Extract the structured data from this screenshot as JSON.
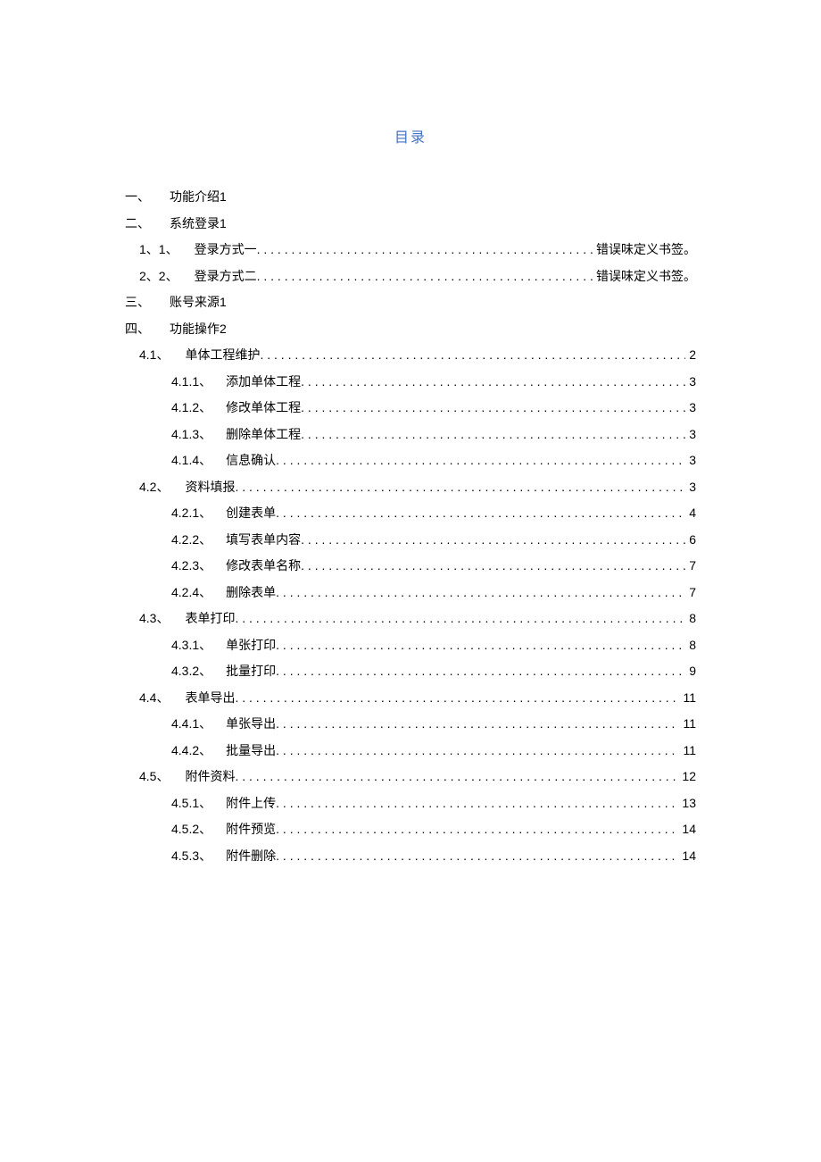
{
  "title": "目录",
  "rows": [
    {
      "indent": 0,
      "leader": false,
      "num": "一、",
      "text": "功能介绍1",
      "page": ""
    },
    {
      "indent": 0,
      "leader": false,
      "num": "二、",
      "text": "系统登录1",
      "page": ""
    },
    {
      "indent": 1,
      "leader": true,
      "num": "1、1、",
      "text": "登录方式一",
      "page": "错误味定义书签。"
    },
    {
      "indent": 1,
      "leader": true,
      "num": "2、2、",
      "text": "登录方式二",
      "page": "错误味定义书签。"
    },
    {
      "indent": 0,
      "leader": false,
      "num": "三、",
      "text": "账号来源1",
      "page": ""
    },
    {
      "indent": 0,
      "leader": false,
      "num": "四、",
      "text": "功能操作2",
      "page": ""
    },
    {
      "indent": 1,
      "leader": true,
      "num": "4.1、",
      "text": "单体工程维护",
      "page": "2"
    },
    {
      "indent": 2,
      "leader": true,
      "num": "4.1.1、",
      "text": "添加单体工程",
      "page": "3"
    },
    {
      "indent": 2,
      "leader": true,
      "num": "4.1.2、",
      "text": "修改单体工程",
      "page": "3"
    },
    {
      "indent": 2,
      "leader": true,
      "num": "4.1.3、",
      "text": "删除单体工程",
      "page": "3"
    },
    {
      "indent": 2,
      "leader": true,
      "num": "4.1.4、",
      "text": "信息确认",
      "page": "3"
    },
    {
      "indent": 1,
      "leader": true,
      "num": "4.2、",
      "text": "资料填报",
      "page": "3"
    },
    {
      "indent": 2,
      "leader": true,
      "num": "4.2.1、",
      "text": "创建表单",
      "page": "4"
    },
    {
      "indent": 2,
      "leader": true,
      "num": "4.2.2、",
      "text": "填写表单内容",
      "page": "6"
    },
    {
      "indent": 2,
      "leader": true,
      "num": "4.2.3、",
      "text": "修改表单名称",
      "page": "7"
    },
    {
      "indent": 2,
      "leader": true,
      "num": "4.2.4、",
      "text": "删除表单",
      "page": "7"
    },
    {
      "indent": 1,
      "leader": true,
      "num": "4.3、",
      "text": "表单打印",
      "page": "8"
    },
    {
      "indent": 2,
      "leader": true,
      "num": "4.3.1、",
      "text": "单张打印",
      "page": "8"
    },
    {
      "indent": 2,
      "leader": true,
      "num": "4.3.2、",
      "text": "批量打印",
      "page": "9"
    },
    {
      "indent": 1,
      "leader": true,
      "num": "4.4、",
      "text": "表单导出",
      "page": "11"
    },
    {
      "indent": 2,
      "leader": true,
      "num": "4.4.1、",
      "text": "单张导出",
      "page": "11"
    },
    {
      "indent": 2,
      "leader": true,
      "num": "4.4.2、",
      "text": "批量导出",
      "page": "11"
    },
    {
      "indent": 1,
      "leader": true,
      "num": "4.5、",
      "text": "附件资料",
      "page": "12"
    },
    {
      "indent": 2,
      "leader": true,
      "num": "4.5.1、",
      "text": "附件上传",
      "page": "13"
    },
    {
      "indent": 2,
      "leader": true,
      "num": "4.5.2、",
      "text": "附件预览",
      "page": "14"
    },
    {
      "indent": 2,
      "leader": true,
      "num": "4.5.3、",
      "text": "附件删除",
      "page": "14"
    }
  ]
}
